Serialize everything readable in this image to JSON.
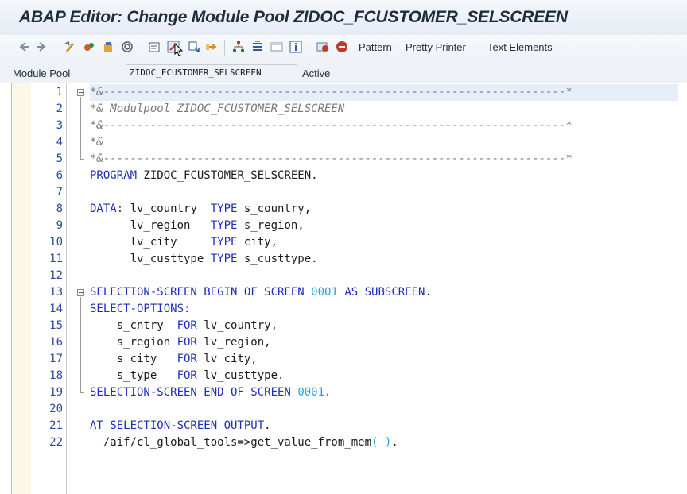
{
  "window": {
    "title": "ABAP Editor: Change Module Pool ZIDOC_FCUSTOMER_SELSCREEN"
  },
  "toolbar": {
    "icons": [
      "back-arrow-icon",
      "forward-arrow-icon",
      "display-change-icon",
      "other-object-icon",
      "activate-icon",
      "where-used-icon",
      "test-icon",
      "check-icon",
      "move-icon",
      "navigation-icon",
      "hierarchy-icon",
      "stack-icon",
      "window-icon",
      "info-icon",
      "breakpoint-icon",
      "session-breakpoint-icon"
    ],
    "pattern_label": "Pattern",
    "pretty_printer_label": "Pretty Printer",
    "text_elements_label": "Text Elements"
  },
  "header": {
    "object_type_label": "Module Pool",
    "object_name": "ZIDOC_FCUSTOMER_SELSCREEN",
    "status": "Active"
  },
  "editor": {
    "line_numbers": [
      "1",
      "2",
      "3",
      "4",
      "5",
      "6",
      "7",
      "8",
      "9",
      "10",
      "11",
      "12",
      "13",
      "14",
      "15",
      "16",
      "17",
      "18",
      "19",
      "20",
      "21",
      "22"
    ],
    "lines": [
      {
        "tokens": [
          {
            "t": "*&---------------------------------------------------------------------*",
            "c": "cm"
          }
        ]
      },
      {
        "tokens": [
          {
            "t": "*& Modulpool ZIDOC_FCUSTOMER_SELSCREEN",
            "c": "cm"
          }
        ]
      },
      {
        "tokens": [
          {
            "t": "*&---------------------------------------------------------------------*",
            "c": "cm"
          }
        ]
      },
      {
        "tokens": [
          {
            "t": "*&",
            "c": "cm"
          }
        ]
      },
      {
        "tokens": [
          {
            "t": "*&---------------------------------------------------------------------*",
            "c": "cm"
          }
        ]
      },
      {
        "tokens": [
          {
            "t": "PROGRAM",
            "c": "kw"
          },
          {
            "t": " ZIDOC_FCUSTOMER_SELSCREEN.",
            "c": "pun"
          }
        ]
      },
      {
        "tokens": []
      },
      {
        "tokens": [
          {
            "t": "DATA:",
            "c": "kw"
          },
          {
            "t": " lv_country  ",
            "c": "pun"
          },
          {
            "t": "TYPE",
            "c": "kw"
          },
          {
            "t": " s_country,",
            "c": "pun"
          }
        ]
      },
      {
        "tokens": [
          {
            "t": "      lv_region   ",
            "c": "pun"
          },
          {
            "t": "TYPE",
            "c": "kw"
          },
          {
            "t": " s_region,",
            "c": "pun"
          }
        ]
      },
      {
        "tokens": [
          {
            "t": "      lv_city     ",
            "c": "pun"
          },
          {
            "t": "TYPE",
            "c": "kw"
          },
          {
            "t": " city,",
            "c": "pun"
          }
        ]
      },
      {
        "tokens": [
          {
            "t": "      lv_custtype ",
            "c": "pun"
          },
          {
            "t": "TYPE",
            "c": "kw"
          },
          {
            "t": " s_custtype.",
            "c": "pun"
          }
        ]
      },
      {
        "tokens": []
      },
      {
        "tokens": [
          {
            "t": "SELECTION-SCREEN BEGIN OF SCREEN",
            "c": "kw"
          },
          {
            "t": " ",
            "c": "pun"
          },
          {
            "t": "0001",
            "c": "num"
          },
          {
            "t": " ",
            "c": "pun"
          },
          {
            "t": "AS SUBSCREEN",
            "c": "kw"
          },
          {
            "t": ".",
            "c": "pun"
          }
        ]
      },
      {
        "tokens": [
          {
            "t": "SELECT-OPTIONS:",
            "c": "kw"
          }
        ]
      },
      {
        "tokens": [
          {
            "t": "    s_cntry  ",
            "c": "pun"
          },
          {
            "t": "FOR",
            "c": "kw"
          },
          {
            "t": " lv_country,",
            "c": "pun"
          }
        ]
      },
      {
        "tokens": [
          {
            "t": "    s_region ",
            "c": "pun"
          },
          {
            "t": "FOR",
            "c": "kw"
          },
          {
            "t": " lv_region,",
            "c": "pun"
          }
        ]
      },
      {
        "tokens": [
          {
            "t": "    s_city   ",
            "c": "pun"
          },
          {
            "t": "FOR",
            "c": "kw"
          },
          {
            "t": " lv_city,",
            "c": "pun"
          }
        ]
      },
      {
        "tokens": [
          {
            "t": "    s_type   ",
            "c": "pun"
          },
          {
            "t": "FOR",
            "c": "kw"
          },
          {
            "t": " lv_custtype.",
            "c": "pun"
          }
        ]
      },
      {
        "tokens": [
          {
            "t": "SELECTION-SCREEN END OF SCREEN",
            "c": "kw"
          },
          {
            "t": " ",
            "c": "pun"
          },
          {
            "t": "0001",
            "c": "num"
          },
          {
            "t": ".",
            "c": "pun"
          }
        ]
      },
      {
        "tokens": []
      },
      {
        "tokens": [
          {
            "t": "AT SELECTION-SCREEN OUTPUT",
            "c": "kw"
          },
          {
            "t": ".",
            "c": "pun"
          }
        ]
      },
      {
        "tokens": [
          {
            "t": "  /aif/cl_global_tools=>get_value_from_mem",
            "c": "pun"
          },
          {
            "t": "( )",
            "c": "num"
          },
          {
            "t": ".",
            "c": "pun"
          }
        ]
      }
    ]
  }
}
